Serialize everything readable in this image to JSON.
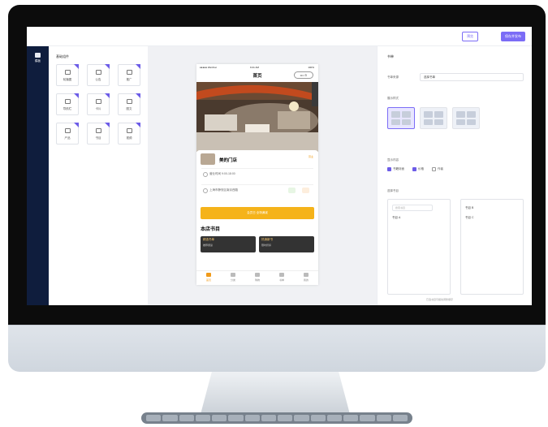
{
  "topbar": {
    "preview_label": "预览",
    "publish_label": "保存并发布"
  },
  "rail": {
    "label": "模板"
  },
  "components": {
    "title": "基础组件",
    "items": [
      {
        "label": "轮播图"
      },
      {
        "label": "公告"
      },
      {
        "label": "推广"
      },
      {
        "label": "导航栏"
      },
      {
        "label": "卡片"
      },
      {
        "label": "图文"
      },
      {
        "label": "产品"
      },
      {
        "label": "书目"
      },
      {
        "label": "视频"
      }
    ]
  },
  "phone": {
    "carrier": "●●●●● WeChat",
    "time": "9:41 AM",
    "battery": "100%",
    "title": "首页",
    "capsule": "••• ⊙",
    "store_name": "美的门店",
    "store_tag": "营业",
    "line1": "营业时间 9:00-18:00",
    "line2": "上海市静安区南京西路",
    "banner": "会员日 全场满减",
    "section_title": "本店书目",
    "books": [
      {
        "title": "精选书单",
        "sub": "推荐阅读"
      },
      {
        "title": "热销新书",
        "sub": "限时折扣"
      }
    ],
    "tabs": [
      {
        "label": "首页",
        "active": true
      },
      {
        "label": "分类",
        "active": false
      },
      {
        "label": "购物",
        "active": false
      },
      {
        "label": "书单",
        "active": false
      },
      {
        "label": "我的",
        "active": false
      }
    ]
  },
  "settings": {
    "title": "书单",
    "source_label": "书单来源",
    "source_value": "选择书单",
    "style_label": "展示样式",
    "show_label": "显示内容",
    "checks": [
      {
        "label": "书籍封面",
        "checked": true
      },
      {
        "label": "价格",
        "checked": true
      },
      {
        "label": "作者",
        "checked": false
      }
    ],
    "list_label": "选择书目",
    "search_placeholder": "搜索书目",
    "left_items": [
      "书目 A"
    ],
    "right_items": [
      "书目 B",
      "书目 C"
    ],
    "hint": "已选书目可拖动调整顺序"
  },
  "colors": {
    "accent": "#7b6cf6",
    "nav": "#0f1d3d",
    "tab_active": "#f09a1a",
    "banner": "#f5b31a"
  }
}
